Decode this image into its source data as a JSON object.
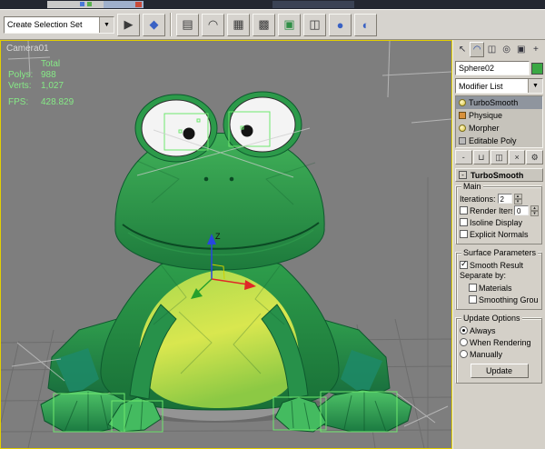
{
  "colors": {
    "viewport_bg": "#7e7e7e",
    "active_viewport_border": "#e3cf00",
    "stats_text": "#86ea86",
    "selection_wire": "#6ee86e",
    "object_color": "#3aa843"
  },
  "ui": {
    "dropdown_arrow": "▼",
    "spinner_up": "▴",
    "spinner_down": "▾",
    "check_glyph": "✓"
  },
  "toolbar": {
    "selection_set_value": "Create Selection Set",
    "icons": [
      {
        "name": "mirror-icon",
        "glyph": "▶"
      },
      {
        "name": "align-icon",
        "glyph": "◆"
      },
      {
        "name": "layer-manager-icon",
        "glyph": "▤"
      },
      {
        "name": "curve-editor-icon",
        "glyph": "◠"
      },
      {
        "name": "schematic-view-icon",
        "glyph": "▦"
      },
      {
        "name": "material-editor-icon",
        "glyph": "▩"
      },
      {
        "name": "render-setup-icon",
        "glyph": "▣"
      },
      {
        "name": "render-type-icon",
        "glyph": "◫"
      },
      {
        "name": "quick-render-icon",
        "glyph": "●"
      },
      {
        "name": "render-last-icon",
        "glyph": "◐"
      }
    ]
  },
  "viewport": {
    "camera_label": "Camera01",
    "gizmo_z_label": "Z",
    "stats": {
      "total_label": "Total",
      "polys_label": "Polys:",
      "polys_value": "988",
      "verts_label": "Verts:",
      "verts_value": "1,027",
      "fps_label": "FPS:",
      "fps_value": "428.829"
    }
  },
  "command_panel": {
    "tabs": [
      {
        "name": "create",
        "glyph": "↖"
      },
      {
        "name": "modify",
        "glyph": "◠"
      },
      {
        "name": "hierarchy",
        "glyph": "◫"
      },
      {
        "name": "motion",
        "glyph": "◎"
      },
      {
        "name": "display",
        "glyph": "▣"
      },
      {
        "name": "utilities",
        "glyph": "+"
      }
    ],
    "object_name": "Sphere02",
    "modifier_list_label": "Modifier List",
    "stack": [
      {
        "label": "TurboSmooth",
        "selected": true
      },
      {
        "label": "Physique",
        "selected": false
      },
      {
        "label": "Morpher",
        "selected": false
      },
      {
        "label": "Editable Poly",
        "selected": false
      }
    ],
    "stack_buttons": [
      {
        "name": "pin-stack",
        "glyph": "-"
      },
      {
        "name": "show-end-result",
        "glyph": "⊔"
      },
      {
        "name": "make-unique",
        "glyph": "◫"
      },
      {
        "name": "remove-modifier",
        "glyph": "×"
      },
      {
        "name": "configure-modifier-sets",
        "glyph": "⚙"
      }
    ],
    "rollout": {
      "title": "TurboSmooth",
      "collapse_glyph": "-",
      "main": {
        "title": "Main",
        "iterations_label": "Iterations:",
        "iterations_value": "2",
        "render_iters_label": "Render Iters:",
        "render_iters_value": "0",
        "isoline_label": "Isoline Display",
        "explicit_normals_label": "Explicit Normals"
      },
      "surface": {
        "title": "Surface Parameters",
        "smooth_result_label": "Smooth Result",
        "separate_by_label": "Separate by:",
        "materials_label": "Materials",
        "smoothing_groups_label": "Smoothing Groups"
      },
      "update": {
        "title": "Update Options",
        "options": [
          "Always",
          "When Rendering",
          "Manually"
        ],
        "selected": "Always",
        "button_label": "Update"
      }
    }
  }
}
